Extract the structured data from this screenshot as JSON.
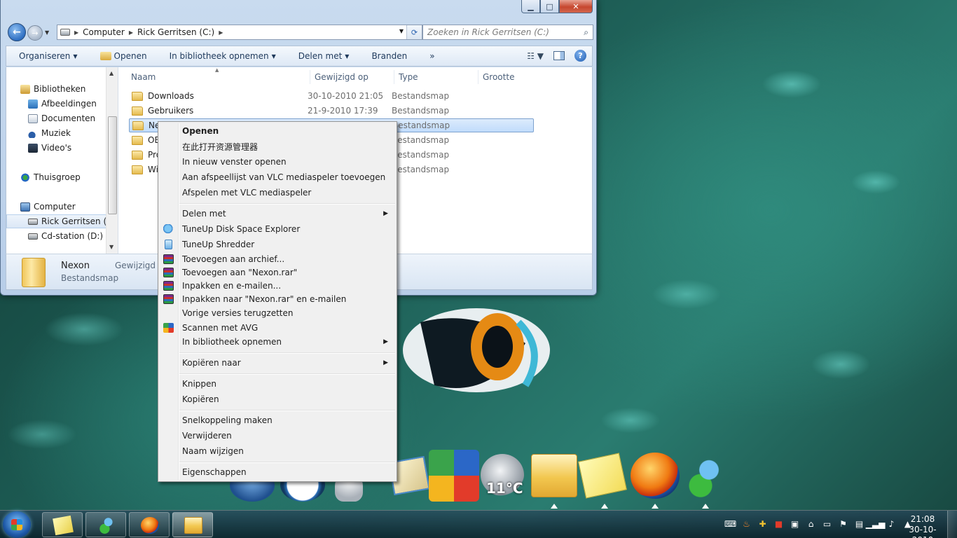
{
  "explorer": {
    "address": {
      "crumbs": [
        "Computer",
        "Rick Gerritsen (C:)"
      ]
    },
    "search_placeholder": "Zoeken in Rick Gerritsen (C:)",
    "toolbar": {
      "organize": "Organiseren",
      "open": "Openen",
      "include_library": "In bibliotheek opnemen",
      "share": "Delen met",
      "burn": "Branden",
      "more": "»"
    },
    "nav_pane": {
      "libraries": "Bibliotheken",
      "pictures": "Afbeeldingen",
      "documents": "Documenten",
      "music": "Muziek",
      "videos": "Video's",
      "homegroup": "Thuisgroep",
      "computer": "Computer",
      "drive_c": "Rick Gerritsen (C:",
      "drive_d": "Cd-station (D:)"
    },
    "columns": {
      "name": "Naam",
      "modified": "Gewijzigd op",
      "type": "Type",
      "size": "Grootte"
    },
    "files": [
      {
        "name": "Downloads",
        "modified": "30-10-2010 21:05",
        "type": "Bestandsmap"
      },
      {
        "name": "Gebruikers",
        "modified": "21-9-2010 17:39",
        "type": "Bestandsmap"
      },
      {
        "name": "Nex",
        "modified": "",
        "type": "Bestandsmap"
      },
      {
        "name": "OEM",
        "modified": "",
        "type": "Bestandsmap"
      },
      {
        "name": "Pro",
        "modified": "",
        "type": "Bestandsmap"
      },
      {
        "name": "Win",
        "modified": "",
        "type": "Bestandsmap"
      }
    ],
    "details": {
      "name": "Nexon",
      "type": "Bestandsmap",
      "modified_label": "Gewijzigd op"
    }
  },
  "context_menu": {
    "open": "Openen",
    "open_cn": "在此打开资源管理器",
    "open_new_window": "In nieuw venster openen",
    "vlc_add": "Aan afspeellijst van VLC mediaspeler toevoegen",
    "vlc_play": "Afspelen met VLC mediaspeler",
    "share": "Delen met",
    "tuneup_disk": "TuneUp Disk Space Explorer",
    "tuneup_shred": "TuneUp Shredder",
    "rar_add": "Toevoegen aan archief...",
    "rar_add_named": "Toevoegen aan \"Nexon.rar\"",
    "rar_email": "Inpakken en e-mailen...",
    "rar_email_named": "Inpakken naar \"Nexon.rar\" en e-mailen",
    "restore": "Vorige versies terugzetten",
    "avg": "Scannen met AVG",
    "library": "In bibliotheek opnemen",
    "send_to": "Kopiëren naar",
    "cut": "Knippen",
    "copy": "Kopiëren",
    "shortcut": "Snelkoppeling maken",
    "delete": "Verwijderen",
    "rename": "Naam wijzigen",
    "properties": "Eigenschappen"
  },
  "dock": {
    "weather_temp": "11°C"
  },
  "taskbar": {
    "time": "21:08",
    "date": "30-10-2010"
  }
}
